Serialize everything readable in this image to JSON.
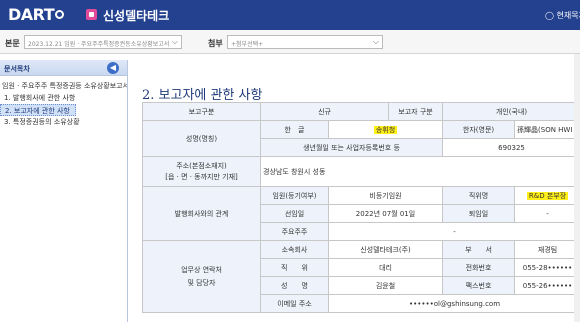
{
  "header": {
    "logo": "DART",
    "company": "신성델타테크",
    "right_text": "◯ 현재목차"
  },
  "filters": {
    "report_label": "본문",
    "report_value": "2023.12.21  임원 · 주요주주특정증권등소유상황보고서",
    "attach_label": "첨부",
    "attach_value": "+첨부선택+"
  },
  "sidebar": {
    "title": "문서목차",
    "collapse": "◀",
    "items": [
      "임원 · 주요주주 특정증권등 소유상황보고서",
      "1. 발행회사에 관한 사항",
      "2. 보고자에 관한 사항",
      "3. 특정증권등의 소유상황"
    ]
  },
  "page": {
    "title": "2. 보고자에 관한 사항"
  },
  "table": {
    "h_type": "보고구분",
    "h_new": "신규",
    "h_reporter": "보고자 구분",
    "h_individual": "개인(국내)",
    "name_label": "성명(명칭)",
    "hangul_label": "한　글",
    "hangul_value": "송휘청",
    "hanja_label": "한자(영문)",
    "hanja_value": "孫輝晶(SON HWI CHANG)",
    "birth_label": "생년월일 또는 사업자등록번호 등",
    "birth_value": "690325",
    "addr_label": "주소(본점소재지)",
    "addr_sub": "[읍 · 면 · 동까지만 기재]",
    "addr_value": "경상남도 창원시 성동",
    "rel_label": "발행회사와의 관계",
    "exec_label": "임원(등기여부)",
    "exec_value": "비등기임원",
    "pos_label": "직위명",
    "pos_value": "R&D 본부장",
    "appt_label": "선임일",
    "appt_value": "2022년 07월 01일",
    "retire_label": "퇴임일",
    "retire_value": "-",
    "major_label": "주요주주",
    "major_value": "-",
    "contact_label": "업무상 연락처",
    "contact_label2": "및 담당자",
    "aff_label": "소속회사",
    "aff_value": "신성델타테크(주)",
    "dept_label": "부　　서",
    "dept_value": "재경팀",
    "title_label": "직　　위",
    "title_value": "대리",
    "phone_label": "전화번호",
    "phone_value": "055-28••••••",
    "person_label": "성　　명",
    "person_value": "김윤철",
    "fax_label": "팩스번호",
    "fax_value": "055-26••••••",
    "email_label": "이메일 주소",
    "email_value": "••••••ol@gshinsung.com"
  }
}
